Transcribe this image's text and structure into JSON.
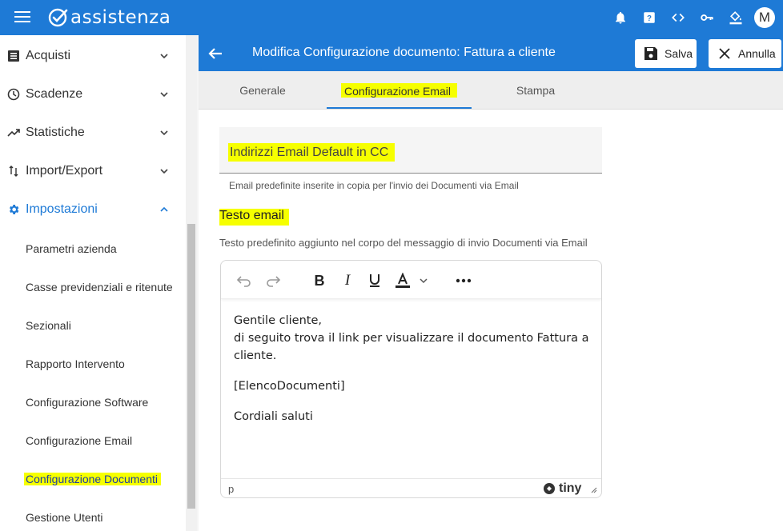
{
  "app": {
    "name": "assistenza",
    "user_initial": "M"
  },
  "topbar": {
    "icons": [
      "bell-icon",
      "help-icon",
      "code-icon",
      "key-icon",
      "paint-bucket-icon"
    ]
  },
  "sidebar": {
    "items": [
      {
        "label": "Acquisti",
        "icon": "list-icon"
      },
      {
        "label": "Scadenze",
        "icon": "clock-icon"
      },
      {
        "label": "Statistiche",
        "icon": "trending-icon"
      },
      {
        "label": "Import/Export",
        "icon": "swap-icon"
      },
      {
        "label": "Impostazioni",
        "icon": "gear-icon"
      }
    ],
    "sub_items": [
      "Parametri azienda",
      "Casse previdenziali e ritenute",
      "Sezionali",
      "Rapporto Intervento",
      "Configurazione Software",
      "Configurazione Email",
      "Configurazione Documenti",
      "Gestione Utenti"
    ]
  },
  "header": {
    "title": "Modifica Configurazione documento: Fattura a cliente",
    "save_label": "Salva",
    "cancel_label": "Annulla"
  },
  "tabs": [
    "Generale",
    "Configurazione Email",
    "Stampa"
  ],
  "form": {
    "cc_label": "Indirizzi Email Default in CC",
    "cc_help": "Email predefinite inserite in copia per l'invio dei Documenti via Email",
    "testo_label": "Testo email",
    "testo_help": "Testo predefinito aggiunto nel corpo del messaggio di invio Documenti via Email"
  },
  "editor": {
    "line1": "Gentile cliente,",
    "line2": "di seguito trova il link per visualizzare il documento Fattura a cliente.",
    "line3": "[ElencoDocumenti]",
    "line4": "Cordiali saluti",
    "status_path": "p",
    "brand": "tiny"
  },
  "colors": {
    "primary": "#1e7ad6",
    "highlight": "#f6ff00"
  }
}
